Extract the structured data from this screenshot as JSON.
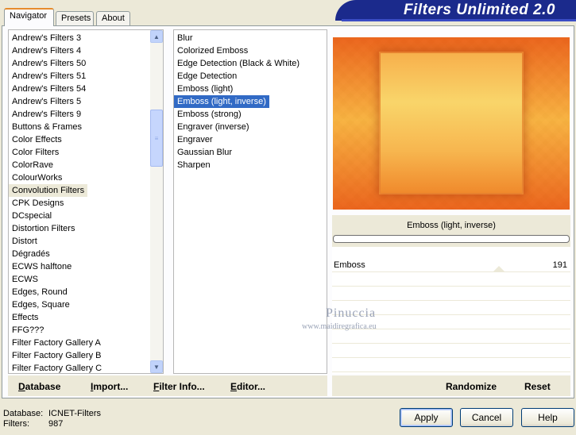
{
  "banner": {
    "title": "Filters Unlimited 2.0"
  },
  "tabs": [
    "Navigator",
    "Presets",
    "About"
  ],
  "categories": [
    "Andrew's Filters 3",
    "Andrew's Filters 4",
    "Andrew's Filters 50",
    "Andrew's Filters 51",
    "Andrew's Filters 54",
    "Andrew's Filters 5",
    "Andrew's Filters 9",
    "Buttons & Frames",
    "Color Effects",
    "Color Filters",
    "ColorRave",
    "ColourWorks",
    "Convolution Filters",
    "CPK Designs",
    "DCspecial",
    "Distortion Filters",
    "Distort",
    "Dégradés",
    "ECWS halftone",
    "ECWS",
    "Edges, Round",
    "Edges, Square",
    "Effects",
    "FFG???",
    "Filter Factory Gallery A",
    "Filter Factory Gallery B",
    "Filter Factory Gallery C"
  ],
  "selected_category": "Convolution Filters",
  "filters": [
    "Blur",
    "Colorized Emboss",
    "Edge Detection (Black & White)",
    "Edge Detection",
    "Emboss (light)",
    "Emboss (light, inverse)",
    "Emboss (strong)",
    "Engraver (inverse)",
    "Engraver",
    "Gaussian Blur",
    "Sharpen"
  ],
  "selected_filter": "Emboss (light, inverse)",
  "preview_filter_name": "Emboss (light, inverse)",
  "params": [
    {
      "label": "Emboss",
      "value": "191",
      "fraction": 0.75
    }
  ],
  "watermark": {
    "name": "Pinuccia",
    "url": "www.maidiregrafica.eu"
  },
  "toolbar": {
    "database": "Database",
    "import": "Import...",
    "filter_info": "Filter Info...",
    "editor": "Editor...",
    "randomize": "Randomize",
    "reset": "Reset"
  },
  "status": {
    "database_label": "Database:",
    "database_value": "ICNET-Filters",
    "filters_label": "Filters:",
    "filters_value": "987"
  },
  "buttons": {
    "apply": "Apply",
    "cancel": "Cancel",
    "help": "Help"
  },
  "colors": {
    "selection": "#316ac5",
    "banner": "#1b2a8c",
    "tab_accent": "#e68b2c"
  }
}
